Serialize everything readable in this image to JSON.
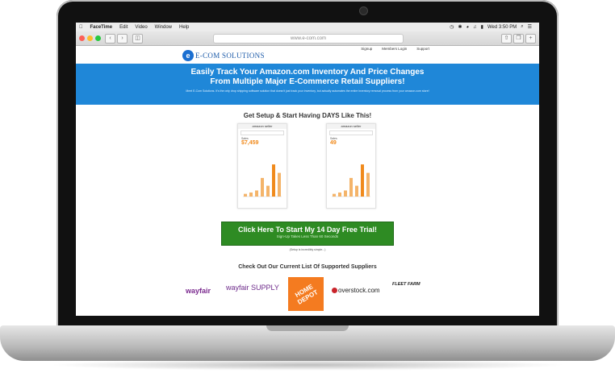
{
  "mac_menubar": {
    "apple": "",
    "items": [
      "FaceTime",
      "Edit",
      "Video",
      "Window",
      "Help"
    ],
    "clock": "Wed 3:50 PM"
  },
  "browser": {
    "url": "www.e-com.com"
  },
  "site": {
    "logo_mark": "e",
    "logo_text": "E-COM SOLUTIONS",
    "top_links": [
      "Signup",
      "Members Login",
      "Support"
    ],
    "hero_title_1": "Easily Track Your Amazon.com Inventory And Price Changes",
    "hero_title_2": "From Multiple Major E-Commerce Retail Suppliers!",
    "hero_sub": "Meet E-Com Solutions. It's the only drop shipping software solution that doesn't just track your inventory, but actually automates the entire inventory removal process from your amazon.com store!",
    "section_title": "Get Setup & Start Having DAYS Like This!",
    "phone_brand": "amazon seller",
    "phone1_label": "Sales",
    "phone1_value": "$7,459",
    "phone2_label": "Sales",
    "phone2_value": "49",
    "cta_main": "Click Here To Start My 14 Day Free Trial!",
    "cta_sub": "Sign-Up Takes Less Than 60 Seconds",
    "setup_note": "(Setup is incredibly simple...)",
    "suppliers_title": "Check Out Our Current List Of Supported Suppliers",
    "supplier_logos": [
      "wayfair",
      "wayfair SUPPLY",
      "HOME DEPOT",
      "overstock.com",
      "FLEET FARM"
    ]
  },
  "phone_bars": [
    0.08,
    0.12,
    0.18,
    0.55,
    0.32,
    0.95,
    0.7
  ]
}
